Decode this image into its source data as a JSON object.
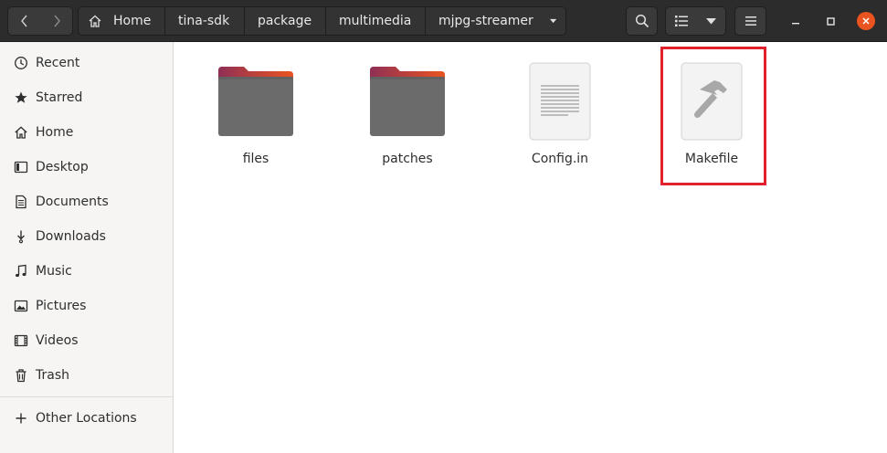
{
  "window": {
    "nav": {
      "back_icon": "chevron-left-icon",
      "forward_icon": "chevron-right-icon"
    },
    "breadcrumbs": [
      "Home",
      "tina-sdk",
      "package",
      "multimedia",
      "mjpg-streamer"
    ],
    "toolbar": {
      "search_icon": "search-icon",
      "view_icon": "list-view-icon",
      "menu_icon": "hamburger-icon"
    },
    "controls": {
      "close_color": "#e95420"
    }
  },
  "sidebar": {
    "items": [
      {
        "label": "Recent",
        "icon": "clock-icon"
      },
      {
        "label": "Starred",
        "icon": "star-icon"
      },
      {
        "label": "Home",
        "icon": "home-icon"
      },
      {
        "label": "Desktop",
        "icon": "desktop-icon"
      },
      {
        "label": "Documents",
        "icon": "document-icon"
      },
      {
        "label": "Downloads",
        "icon": "download-icon"
      },
      {
        "label": "Music",
        "icon": "music-icon"
      },
      {
        "label": "Pictures",
        "icon": "picture-icon"
      },
      {
        "label": "Videos",
        "icon": "video-icon"
      },
      {
        "label": "Trash",
        "icon": "trash-icon"
      }
    ],
    "other_locations": {
      "label": "Other Locations",
      "icon": "plus-icon"
    }
  },
  "files": [
    {
      "name": "files",
      "type": "folder"
    },
    {
      "name": "patches",
      "type": "folder"
    },
    {
      "name": "Config.in",
      "type": "text"
    },
    {
      "name": "Makefile",
      "type": "makefile"
    }
  ],
  "annotation": {
    "target": "Makefile",
    "color": "#e0202c"
  }
}
